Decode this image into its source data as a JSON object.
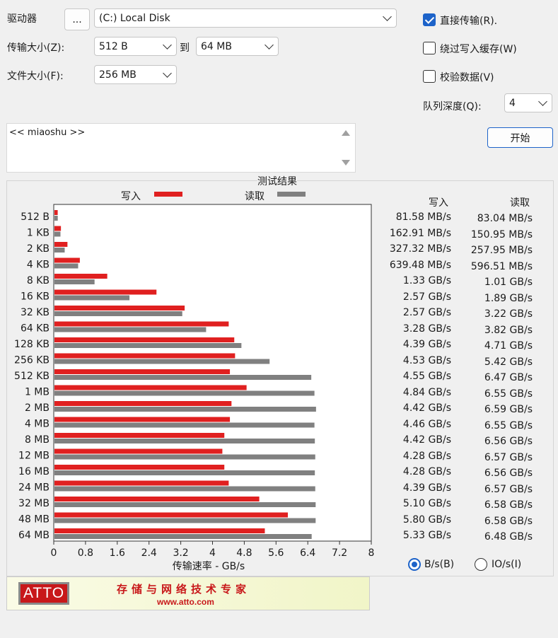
{
  "drive": {
    "label": "驱动器",
    "browse_label": "...",
    "value": "(C:) Local Disk"
  },
  "transfer_size": {
    "label": "传输大小(Z):",
    "from": "512 B",
    "to_label": "到",
    "to": "64 MB"
  },
  "file_size": {
    "label": "文件大小(F):",
    "value": "256 MB"
  },
  "options": {
    "direct_io": {
      "label": "直接传输(R).",
      "checked": true
    },
    "bypass_write_cache": {
      "label": "绕过写入缓存(W)",
      "checked": false
    },
    "verify_data": {
      "label": "校验数据(V)",
      "checked": false
    },
    "queue_depth": {
      "label": "队列深度(Q):",
      "value": "4"
    }
  },
  "start_button": "开始",
  "description": "<< miaoshu >>",
  "results": {
    "title": "测试结果",
    "write_header": "写入",
    "read_header": "读取",
    "unit_bytes_label": "B/s(B)",
    "unit_io_label": "IO/s(I)",
    "selected_unit": "B/s",
    "rows": [
      {
        "size": "512 B",
        "write": "81.58 MB/s",
        "read": "83.04 MB/s"
      },
      {
        "size": "1 KB",
        "write": "162.91 MB/s",
        "read": "150.95 MB/s"
      },
      {
        "size": "2 KB",
        "write": "327.32 MB/s",
        "read": "257.95 MB/s"
      },
      {
        "size": "4 KB",
        "write": "639.48 MB/s",
        "read": "596.51 MB/s"
      },
      {
        "size": "8 KB",
        "write": "1.33 GB/s",
        "read": "1.01 GB/s"
      },
      {
        "size": "16 KB",
        "write": "2.57 GB/s",
        "read": "1.89 GB/s"
      },
      {
        "size": "32 KB",
        "write": "2.57 GB/s",
        "read": "3.22 GB/s"
      },
      {
        "size": "64 KB",
        "write": "3.28 GB/s",
        "read": "3.82 GB/s"
      },
      {
        "size": "128 KB",
        "write": "4.39 GB/s",
        "read": "4.71 GB/s"
      },
      {
        "size": "256 KB",
        "write": "4.53 GB/s",
        "read": "5.42 GB/s"
      },
      {
        "size": "512 KB",
        "write": "4.55 GB/s",
        "read": "6.47 GB/s"
      },
      {
        "size": "1 MB",
        "write": "4.84 GB/s",
        "read": "6.55 GB/s"
      },
      {
        "size": "2 MB",
        "write": "4.42 GB/s",
        "read": "6.59 GB/s"
      },
      {
        "size": "4 MB",
        "write": "4.46 GB/s",
        "read": "6.55 GB/s"
      },
      {
        "size": "8 MB",
        "write": "4.42 GB/s",
        "read": "6.56 GB/s"
      },
      {
        "size": "12 MB",
        "write": "4.28 GB/s",
        "read": "6.57 GB/s"
      },
      {
        "size": "16 MB",
        "write": "4.28 GB/s",
        "read": "6.56 GB/s"
      },
      {
        "size": "24 MB",
        "write": "4.39 GB/s",
        "read": "6.57 GB/s"
      },
      {
        "size": "32 MB",
        "write": "5.10 GB/s",
        "read": "6.58 GB/s"
      },
      {
        "size": "48 MB",
        "write": "5.80 GB/s",
        "read": "6.58 GB/s"
      },
      {
        "size": "64 MB",
        "write": "5.33 GB/s",
        "read": "6.48 GB/s"
      }
    ]
  },
  "chart_data": {
    "type": "bar",
    "orientation": "horizontal",
    "categories": [
      "512 B",
      "1 KB",
      "2 KB",
      "4 KB",
      "8 KB",
      "16 KB",
      "32 KB",
      "64 KB",
      "128 KB",
      "256 KB",
      "512 KB",
      "1 MB",
      "2 MB",
      "4 MB",
      "8 MB",
      "12 MB",
      "16 MB",
      "24 MB",
      "32 MB",
      "48 MB",
      "64 MB"
    ],
    "series": [
      {
        "name": "写入",
        "color": "#e02020",
        "values": [
          0.08158,
          0.16291,
          0.32732,
          0.63948,
          1.33,
          2.57,
          3.28,
          4.39,
          4.53,
          4.55,
          4.42,
          4.84,
          4.46,
          4.42,
          4.28,
          4.23,
          4.28,
          4.39,
          5.16,
          5.88,
          5.3
        ]
      },
      {
        "name": "读取",
        "color": "#808080",
        "values": [
          0.08304,
          0.15095,
          0.25795,
          0.59651,
          1.01,
          1.89,
          3.22,
          3.82,
          4.71,
          5.42,
          6.47,
          6.55,
          6.59,
          6.55,
          6.56,
          6.57,
          6.56,
          6.57,
          6.58,
          6.58,
          6.48
        ]
      }
    ],
    "xlabel": "传输速率 - GB/s",
    "xlim": [
      0,
      8
    ],
    "xticks": [
      "0",
      "0.8",
      "1.6",
      "2.4",
      "3.2",
      "4",
      "4.8",
      "5.6",
      "6.4",
      "7.2",
      "8"
    ],
    "legend_position": "top",
    "grid": false
  },
  "banner": {
    "logo": "ATTO",
    "slogan": "存储与网络技术专家",
    "url": "www.atto.com"
  },
  "colors": {
    "accent": "#1d63c9",
    "write": "#e02020",
    "read": "#808080",
    "brand": "#c8181a"
  }
}
